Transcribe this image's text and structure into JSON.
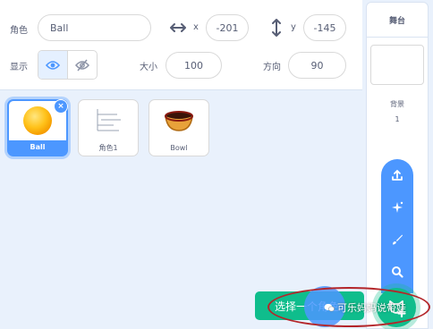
{
  "sprite_info": {
    "sprite_label": "角色",
    "sprite_name": "Ball",
    "x_label": "x",
    "x_value": "-201",
    "y_label": "y",
    "y_value": "-145",
    "show_label": "显示",
    "size_label": "大小",
    "size_value": "100",
    "direction_label": "方向",
    "direction_value": "90"
  },
  "sprites": [
    {
      "name": "Ball",
      "selected": true
    },
    {
      "name": "角色1",
      "selected": false
    },
    {
      "name": "Bowl",
      "selected": false
    }
  ],
  "stage": {
    "title": "舞台",
    "backdrop_label": "背景",
    "backdrop_count": "1"
  },
  "fab_menu": {
    "items": [
      "upload-icon",
      "surprise-icon",
      "paint-icon",
      "search-icon"
    ],
    "tooltip": "选择一个角色"
  },
  "watermark": "可乐妈妈说带娃",
  "colors": {
    "accent": "#4c97ff",
    "fab_green": "#0fbd8c",
    "annotation": "#b3262a"
  }
}
